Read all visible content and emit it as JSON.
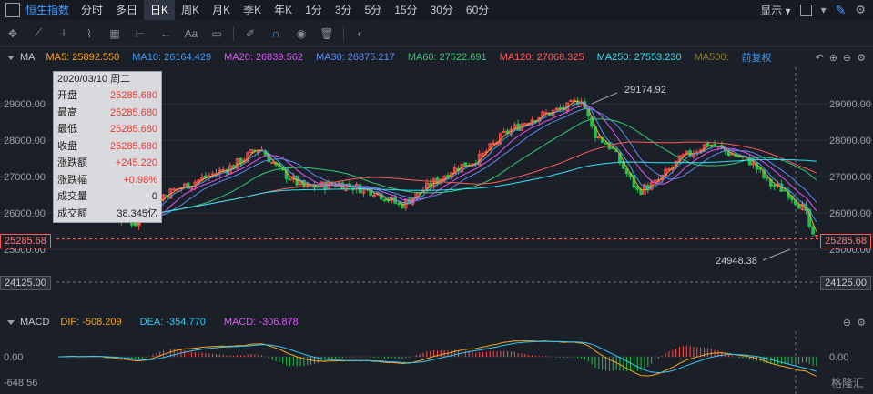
{
  "topbar": {
    "symbol": "恒生指数",
    "tabs": [
      "分时",
      "多日",
      "日K",
      "周K",
      "月K",
      "季K",
      "年K",
      "1分",
      "3分",
      "5分",
      "15分",
      "30分",
      "60分"
    ],
    "active_tab": "日K",
    "display_label": "显示"
  },
  "ma_bar": {
    "name": "MA",
    "items": [
      {
        "label": "MA5: 25892.550",
        "color": "#f5a623"
      },
      {
        "label": "MA10: 26164.429",
        "color": "#3d9bff"
      },
      {
        "label": "MA20: 26839.562",
        "color": "#e056fd"
      },
      {
        "label": "MA30: 26875.217",
        "color": "#5b8def"
      },
      {
        "label": "MA60: 27522.691",
        "color": "#2ecc71"
      },
      {
        "label": "MA120: 27068.325",
        "color": "#ff5c5c"
      },
      {
        "label": "MA250: 27553.230",
        "color": "#31e1f7"
      },
      {
        "label": "MA500:",
        "color": "#8a7a3a"
      }
    ],
    "fuquan": "前复权"
  },
  "info": {
    "date": "2020/03/10 周二",
    "rows": [
      {
        "k": "开盘",
        "v": "25285.680",
        "dark": false
      },
      {
        "k": "最高",
        "v": "25285.680",
        "dark": false
      },
      {
        "k": "最低",
        "v": "25285.680",
        "dark": false
      },
      {
        "k": "收盘",
        "v": "25285.680",
        "dark": false
      },
      {
        "k": "涨跌额",
        "v": "+245.220",
        "dark": false
      },
      {
        "k": "涨跌幅",
        "v": "+0.98%",
        "dark": false
      },
      {
        "k": "成交量",
        "v": "0",
        "dark": true
      },
      {
        "k": "成交额",
        "v": "38.345亿",
        "dark": true
      }
    ]
  },
  "price_axis": {
    "ticks": [
      "29000.00",
      "28000.00",
      "27000.00",
      "26000.00",
      "25000.00"
    ],
    "current": "25285.68",
    "low_line": "24125.00",
    "high_annot": "29174.92",
    "low_annot": "24948.38"
  },
  "macd_bar": {
    "name": "MACD",
    "items": [
      {
        "label": "DIF: -508.209",
        "color": "#f5a623"
      },
      {
        "label": "DEA: -354.770",
        "color": "#31c8f7"
      },
      {
        "label": "MACD: -306.878",
        "color": "#e056fd"
      }
    ],
    "left_ticks": [
      "0.00",
      "-648.56"
    ],
    "right_ticks": [
      "0.00"
    ]
  },
  "watermark": "格隆汇",
  "colors": {
    "up": "#ff4d4f",
    "down": "#1fc24a"
  }
}
